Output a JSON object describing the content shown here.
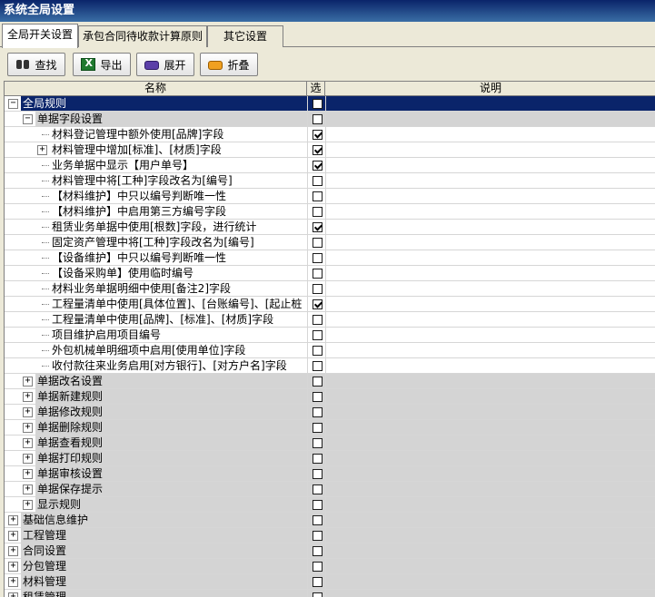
{
  "window": {
    "title": "系统全局设置"
  },
  "tabs": [
    {
      "label": "全局开关设置",
      "active": true
    },
    {
      "label": "承包合同待收款计算原则",
      "active": false
    },
    {
      "label": "其它设置",
      "active": false
    }
  ],
  "toolbar": {
    "find_label": "查找",
    "export_label": "导出",
    "expand_label": "展开",
    "collapse_label": "折叠"
  },
  "grid": {
    "columns": {
      "name": "名称",
      "select": "选",
      "description": "说明"
    },
    "rows": [
      {
        "label": "全局规则",
        "level": 0,
        "expander": "−",
        "checked": false,
        "kind": "selected"
      },
      {
        "label": "单据字段设置",
        "level": 1,
        "expander": "−",
        "checked": false,
        "kind": "group"
      },
      {
        "label": "材料登记管理中额外使用[品牌]字段",
        "level": 2,
        "expander": "",
        "checked": true,
        "kind": "item"
      },
      {
        "label": "材料管理中增加[标准]、[材质]字段",
        "level": 2,
        "expander": "+",
        "checked": true,
        "kind": "item"
      },
      {
        "label": "业务单据中显示【用户单号】",
        "level": 2,
        "expander": "",
        "checked": true,
        "kind": "item"
      },
      {
        "label": "材料管理中将[工种]字段改名为[编号]",
        "level": 2,
        "expander": "",
        "checked": false,
        "kind": "item"
      },
      {
        "label": "【材料维护】中只以编号判断唯一性",
        "level": 2,
        "expander": "",
        "checked": false,
        "kind": "item"
      },
      {
        "label": "【材料维护】中启用第三方编号字段",
        "level": 2,
        "expander": "",
        "checked": false,
        "kind": "item"
      },
      {
        "label": "租赁业务单据中使用[根数]字段，进行统计",
        "level": 2,
        "expander": "",
        "checked": true,
        "kind": "item"
      },
      {
        "label": "固定资产管理中将[工种]字段改名为[编号]",
        "level": 2,
        "expander": "",
        "checked": false,
        "kind": "item"
      },
      {
        "label": "【设备维护】中只以编号判断唯一性",
        "level": 2,
        "expander": "",
        "checked": false,
        "kind": "item"
      },
      {
        "label": "【设备采购单】使用临时编号",
        "level": 2,
        "expander": "",
        "checked": false,
        "kind": "item"
      },
      {
        "label": "材料业务单据明细中使用[备注2]字段",
        "level": 2,
        "expander": "",
        "checked": false,
        "kind": "item"
      },
      {
        "label": "工程量清单中使用[具体位置]、[台账编号]、[起止桩",
        "level": 2,
        "expander": "",
        "checked": true,
        "kind": "item"
      },
      {
        "label": "工程量清单中使用[品牌]、[标准]、[材质]字段",
        "level": 2,
        "expander": "",
        "checked": false,
        "kind": "item"
      },
      {
        "label": "项目维护启用项目编号",
        "level": 2,
        "expander": "",
        "checked": false,
        "kind": "item"
      },
      {
        "label": "外包机械单明细项中启用[使用单位]字段",
        "level": 2,
        "expander": "",
        "checked": false,
        "kind": "item"
      },
      {
        "label": "收付款往来业务启用[对方银行]、[对方户名]字段",
        "level": 2,
        "expander": "",
        "checked": false,
        "kind": "item"
      },
      {
        "label": "单据改名设置",
        "level": 1,
        "expander": "+",
        "checked": false,
        "kind": "group"
      },
      {
        "label": "单据新建规则",
        "level": 1,
        "expander": "+",
        "checked": false,
        "kind": "group"
      },
      {
        "label": "单据修改规则",
        "level": 1,
        "expander": "+",
        "checked": false,
        "kind": "group"
      },
      {
        "label": "单据删除规则",
        "level": 1,
        "expander": "+",
        "checked": false,
        "kind": "group"
      },
      {
        "label": "单据查看规则",
        "level": 1,
        "expander": "+",
        "checked": false,
        "kind": "group"
      },
      {
        "label": "单据打印规则",
        "level": 1,
        "expander": "+",
        "checked": false,
        "kind": "group"
      },
      {
        "label": "单据审核设置",
        "level": 1,
        "expander": "+",
        "checked": false,
        "kind": "group"
      },
      {
        "label": "单据保存提示",
        "level": 1,
        "expander": "+",
        "checked": false,
        "kind": "group"
      },
      {
        "label": "显示规则",
        "level": 1,
        "expander": "+",
        "checked": false,
        "kind": "group"
      },
      {
        "label": "基础信息维护",
        "level": 0,
        "expander": "+",
        "checked": false,
        "kind": "group"
      },
      {
        "label": "工程管理",
        "level": 0,
        "expander": "+",
        "checked": false,
        "kind": "group"
      },
      {
        "label": "合同设置",
        "level": 0,
        "expander": "+",
        "checked": false,
        "kind": "group"
      },
      {
        "label": "分包管理",
        "level": 0,
        "expander": "+",
        "checked": false,
        "kind": "group"
      },
      {
        "label": "材料管理",
        "level": 0,
        "expander": "+",
        "checked": false,
        "kind": "group"
      },
      {
        "label": "租赁管理",
        "level": 0,
        "expander": "+",
        "checked": false,
        "kind": "group"
      }
    ]
  }
}
